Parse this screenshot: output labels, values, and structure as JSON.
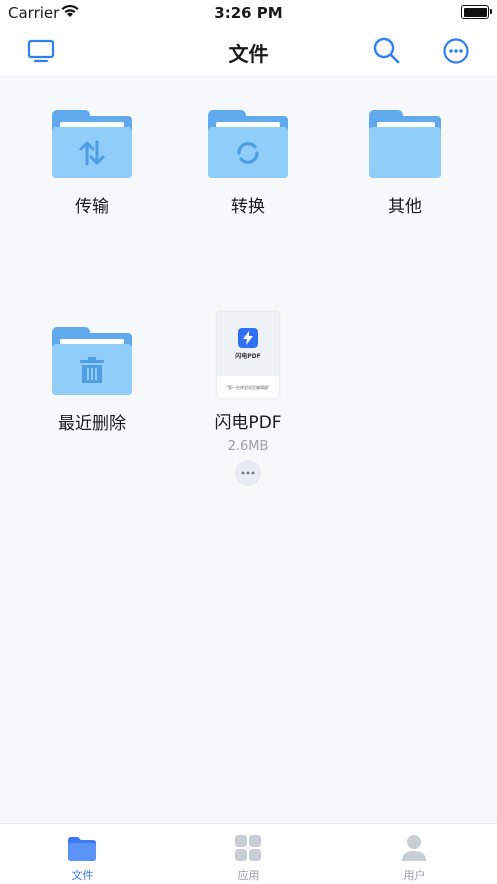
{
  "status_bar": {
    "carrier": "Carrier",
    "time": "3:26 PM"
  },
  "nav": {
    "title": "文件"
  },
  "folders": [
    {
      "label": "传输",
      "icon": "transfer-arrows-icon"
    },
    {
      "label": "转换",
      "icon": "convert-refresh-icon"
    },
    {
      "label": "其他",
      "icon": "folder-icon"
    },
    {
      "label": "最近删除",
      "icon": "trash-icon"
    }
  ],
  "file": {
    "name": "闪电PDF",
    "size": "2.6MB",
    "thumb_title": "闪电PDF",
    "thumb_slogan": "\"第一台体验语言编辑器\""
  },
  "tabs": [
    {
      "label": "文件",
      "icon": "folder-icon",
      "active": true
    },
    {
      "label": "应用",
      "icon": "apps-grid-icon",
      "active": false
    },
    {
      "label": "用户",
      "icon": "user-icon",
      "active": false
    }
  ],
  "colors": {
    "accent": "#3d7cf5",
    "folder_dark": "#5fa9ec",
    "folder_light": "#90cdf8",
    "inactive": "#9aa0a8"
  }
}
